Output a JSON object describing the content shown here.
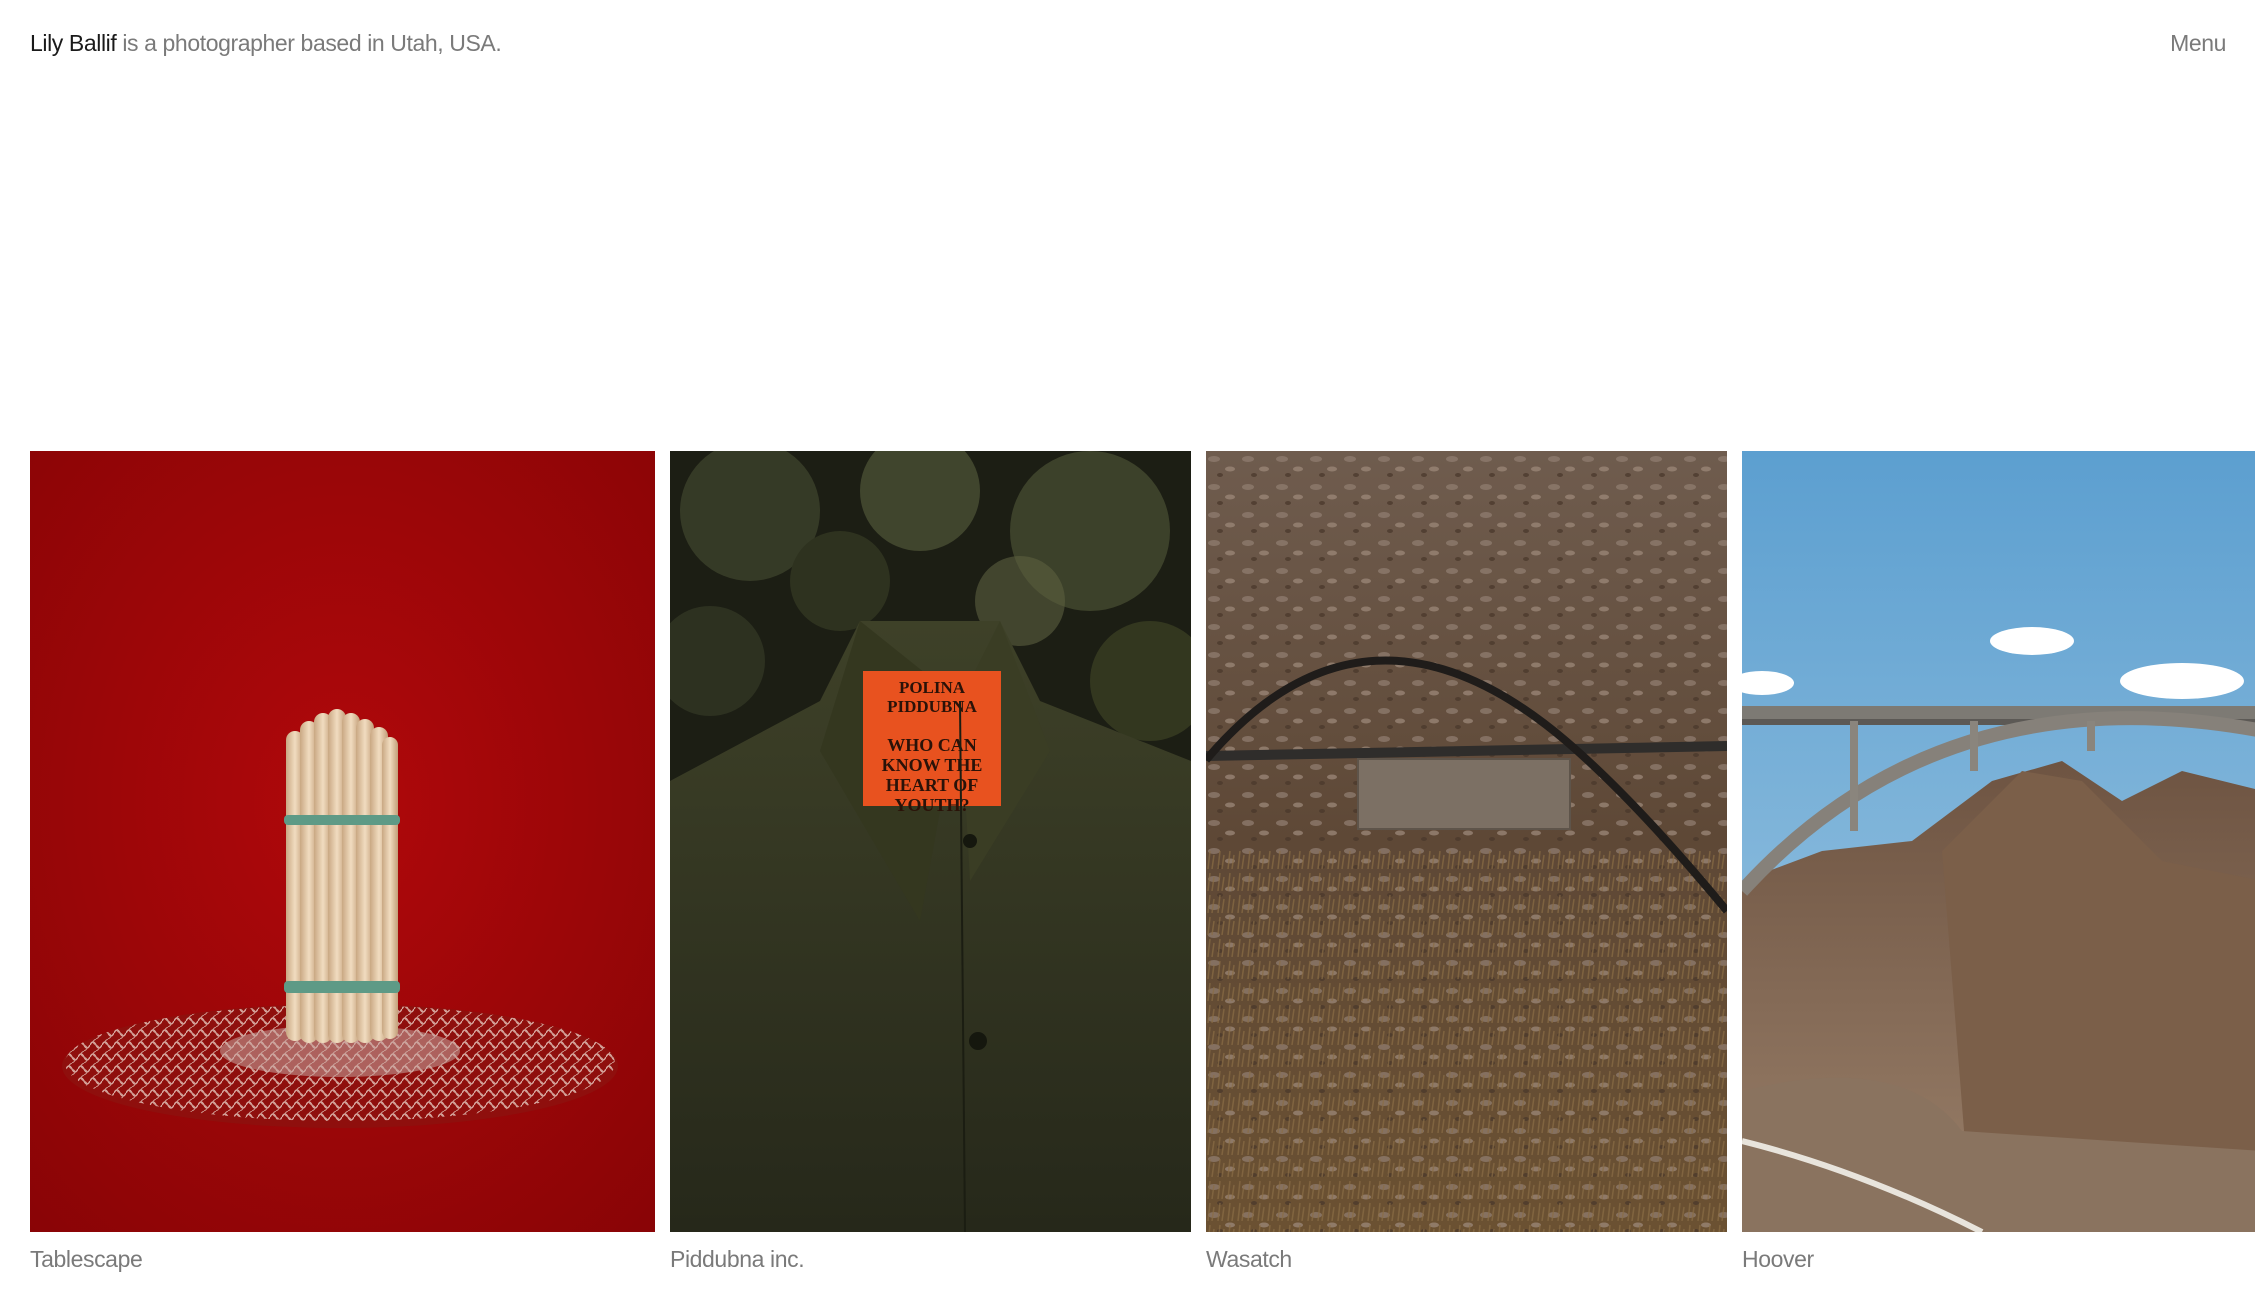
{
  "header": {
    "name_link": "Lily Ballif",
    "tagline": " is a photographer based in Utah, USA.",
    "menu_label": "Menu"
  },
  "projects": [
    {
      "title": "Tablescape",
      "image": "white asparagus bundle on lace doily against red backdrop"
    },
    {
      "title": "Piddubna inc.",
      "image": "dark green shirt with orange label",
      "label_lines": [
        "POLINA",
        "PIDDUBNA",
        "WHO CAN",
        "KNOW THE",
        "HEART OF",
        "YOUTH?"
      ]
    },
    {
      "title": "Wasatch",
      "image": "rocky dry ground with cable and blank metal sign"
    },
    {
      "title": "Hoover",
      "image": "arch bridge over desert canyon with blue sky"
    }
  ],
  "colors": {
    "text_dark": "#1a1a1a",
    "text_muted": "#7a7a7a",
    "background": "#ffffff"
  }
}
